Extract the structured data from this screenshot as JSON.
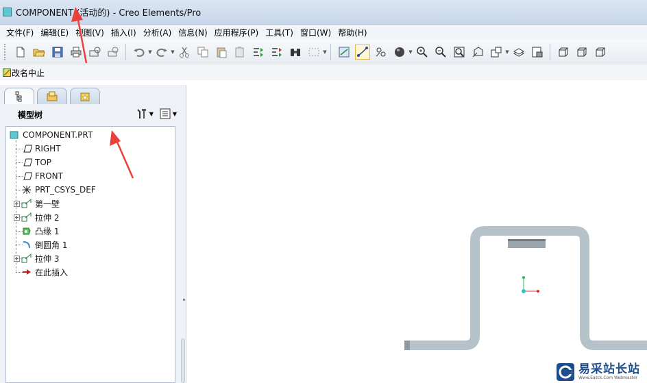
{
  "window": {
    "title": "COMPONENT (活动的) - Creo Elements/Pro"
  },
  "menu": [
    "文件(F)",
    "编辑(E)",
    "视图(V)",
    "插入(I)",
    "分析(A)",
    "信息(N)",
    "应用程序(P)",
    "工具(T)",
    "窗口(W)",
    "帮助(H)"
  ],
  "status": {
    "text": "改名中止"
  },
  "model_tree": {
    "title": "模型树",
    "items": [
      {
        "label": "COMPONENT.PRT",
        "icon": "part-icon",
        "expandable": false
      },
      {
        "label": "RIGHT",
        "icon": "datum-plane-icon",
        "expandable": false
      },
      {
        "label": "TOP",
        "icon": "datum-plane-icon",
        "expandable": false
      },
      {
        "label": "FRONT",
        "icon": "datum-plane-icon",
        "expandable": false
      },
      {
        "label": "PRT_CSYS_DEF",
        "icon": "coordinate-system-icon",
        "expandable": false
      },
      {
        "label": "第一壁",
        "icon": "sheetmetal-wall-icon",
        "expandable": true
      },
      {
        "label": "拉伸 2",
        "icon": "extrude-icon",
        "expandable": true
      },
      {
        "label": "凸缘 1",
        "icon": "flange-icon",
        "expandable": false
      },
      {
        "label": "倒圆角 1",
        "icon": "round-icon",
        "expandable": false
      },
      {
        "label": "拉伸 3",
        "icon": "extrude-icon",
        "expandable": true
      },
      {
        "label": "在此插入",
        "icon": "insert-here-arrow-icon",
        "expandable": false
      }
    ]
  },
  "watermark": {
    "main": "易采站长站",
    "sub": "Www.Easck.Com Webmaster"
  },
  "colors": {
    "part_color": "#b4c0c8",
    "annotation_arrow": "#e8403a",
    "csys_x": "#d9342b",
    "csys_y": "#2fb84a",
    "csys_origin": "#33c3d0"
  }
}
